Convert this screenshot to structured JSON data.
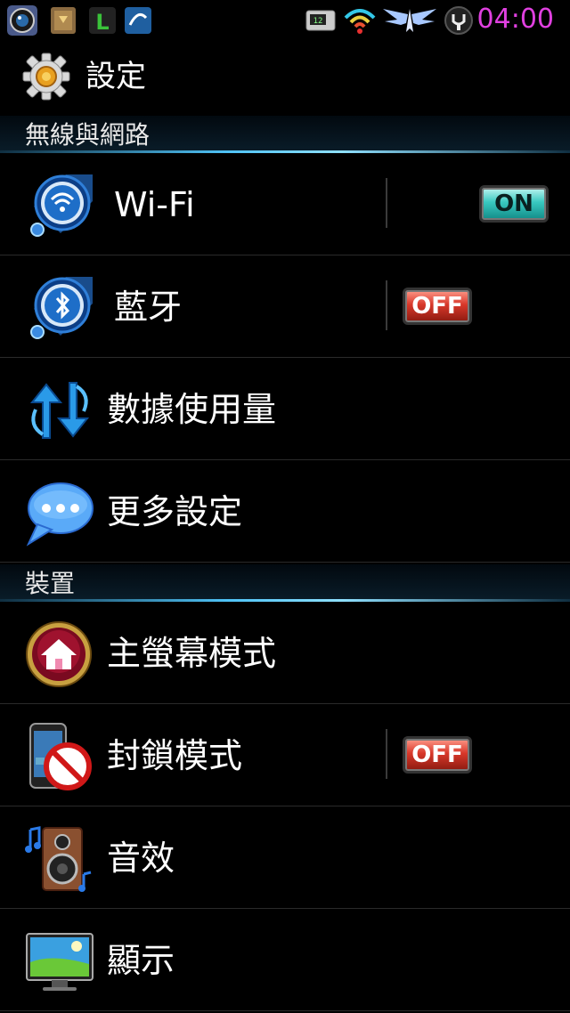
{
  "status_bar": {
    "time": "04:00",
    "time_color": "#e040e0",
    "icons": [
      "camera-app-icon",
      "book-app-icon",
      "green-l-app-icon",
      "blue-app-icon",
      "clock-widget-icon",
      "wifi-signal-icon",
      "winged-emblem-icon",
      "charging-icon"
    ]
  },
  "header": {
    "title": "設定",
    "icon": "gear-icon"
  },
  "sections": [
    {
      "title": "無線與網路",
      "items": [
        {
          "label": "Wi-Fi",
          "icon": "wifi-icon",
          "toggle": "ON"
        },
        {
          "label": "藍牙",
          "icon": "bluetooth-icon",
          "toggle": "OFF"
        },
        {
          "label": "數據使用量",
          "icon": "data-usage-icon"
        },
        {
          "label": "更多設定",
          "icon": "chat-bubble-icon"
        }
      ]
    },
    {
      "title": "裝置",
      "items": [
        {
          "label": "主螢幕模式",
          "icon": "home-icon"
        },
        {
          "label": "封鎖模式",
          "icon": "block-phone-icon",
          "toggle": "OFF"
        },
        {
          "label": "音效",
          "icon": "speaker-icon"
        },
        {
          "label": "顯示",
          "icon": "display-icon"
        }
      ]
    }
  ]
}
